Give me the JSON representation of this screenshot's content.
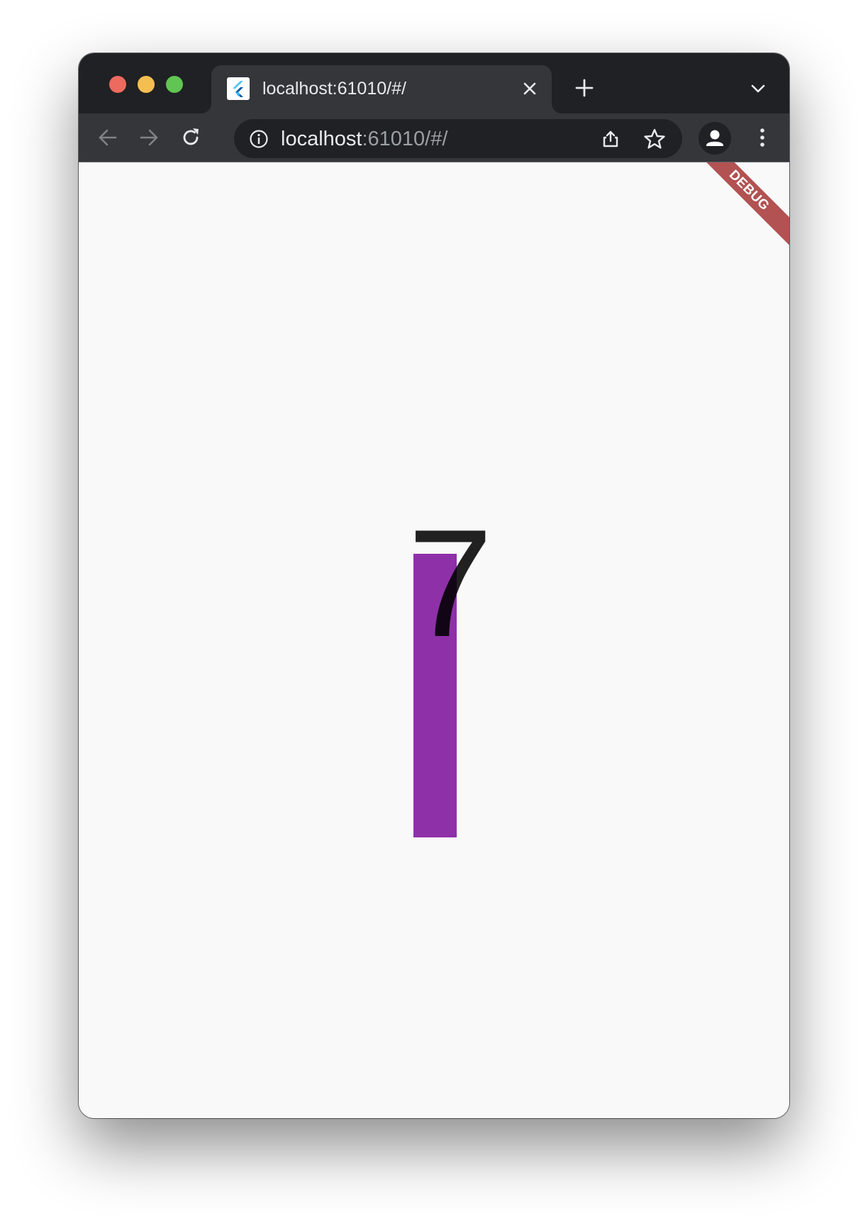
{
  "window": {
    "traffic_lights": [
      "close",
      "minimize",
      "maximize"
    ]
  },
  "tab": {
    "title": "localhost:61010/#/",
    "favicon": "flutter-logo-icon"
  },
  "toolbar": {
    "back_icon": "back-arrow-icon",
    "forward_icon": "forward-arrow-icon",
    "reload_icon": "reload-icon"
  },
  "omnibox": {
    "host": "localhost",
    "path": ":61010/#/",
    "info_icon": "site-info-icon",
    "share_icon": "share-icon",
    "bookmark_icon": "star-icon"
  },
  "profile": {
    "icon": "profile-avatar-icon"
  },
  "page": {
    "display_value": "7",
    "bar_color": "#8e30a8",
    "background_color": "#f9f9f9",
    "debug_banner": "DEBUG",
    "debug_banner_color": "#a22d2d"
  }
}
